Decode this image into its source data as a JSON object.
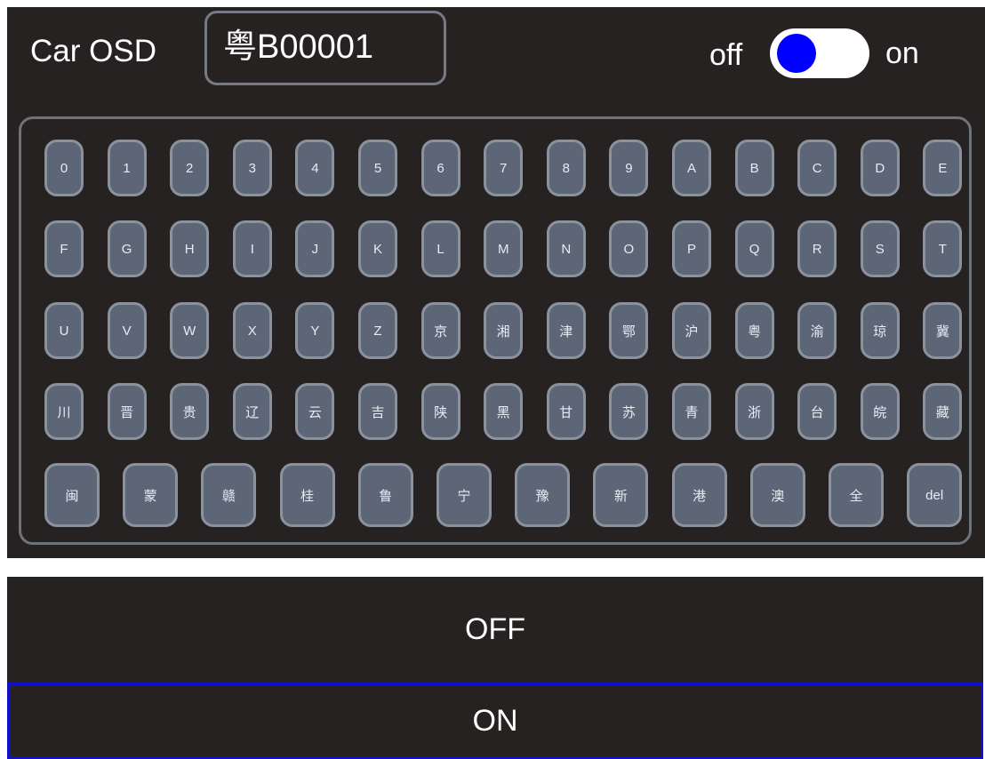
{
  "header": {
    "title": "Car OSD",
    "plate_value": "粤B00001",
    "toggle_off_label": "off",
    "toggle_on_label": "on"
  },
  "toggle": {
    "state": "off",
    "knob_color": "#0000ff",
    "track_color": "#ffffff"
  },
  "keyboard": {
    "rows": [
      [
        "0",
        "1",
        "2",
        "3",
        "4",
        "5",
        "6",
        "7",
        "8",
        "9",
        "A",
        "B",
        "C",
        "D",
        "E"
      ],
      [
        "F",
        "G",
        "H",
        "I",
        "J",
        "K",
        "L",
        "M",
        "N",
        "O",
        "P",
        "Q",
        "R",
        "S",
        "T"
      ],
      [
        "U",
        "V",
        "W",
        "X",
        "Y",
        "Z",
        "京",
        "湘",
        "津",
        "鄂",
        "沪",
        "粤",
        "渝",
        "琼",
        "冀"
      ],
      [
        "川",
        "晋",
        "贵",
        "辽",
        "云",
        "吉",
        "陕",
        "黑",
        "甘",
        "苏",
        "青",
        "浙",
        "台",
        "皖",
        "藏"
      ],
      [
        "闽",
        "蒙",
        "赣",
        "桂",
        "鲁",
        "宁",
        "豫",
        "新",
        "港",
        "澳",
        "全",
        "del"
      ]
    ]
  },
  "options": {
    "off_label": "OFF",
    "on_label": "ON",
    "selected": "ON"
  },
  "colors": {
    "panel_bg": "#272222",
    "key_fill": "#5c6677",
    "key_border": "#8b929c",
    "selected_border": "#1010c8"
  }
}
